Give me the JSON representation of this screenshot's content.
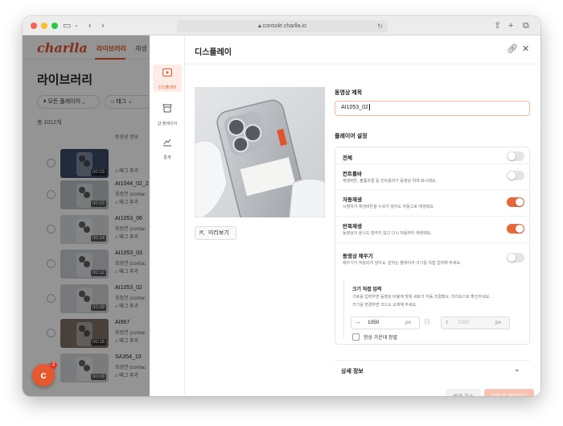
{
  "browser": {
    "url": "console.charlla.io"
  },
  "app": {
    "logo": "charlla",
    "nav": {
      "library": "라이브러리",
      "playlist": "재생"
    },
    "page_title": "라이브러리",
    "filters": {
      "all_playlists": "모든 플레이어",
      "tags": "태그"
    },
    "total": "총 1012개",
    "col_header": "동영상 정보",
    "rows": [
      {
        "name": "",
        "owner": "",
        "tag": "태그 추가",
        "duration": "00:03"
      },
      {
        "name": "AI1044_02_2",
        "owner": "최정연 (contac",
        "tag": "태그 추가",
        "duration": "00:03"
      },
      {
        "name": "AI1053_06",
        "owner": "최정연 (contac",
        "tag": "태그 추가",
        "duration": "00:14"
      },
      {
        "name": "AI1053_03",
        "owner": "최정연 (contac",
        "tag": "태그 추가",
        "duration": "00:12"
      },
      {
        "name": "AI1053_02",
        "owner": "최정연 (contac",
        "tag": "태그 추가",
        "duration": "00:09"
      },
      {
        "name": "AI967",
        "owner": "최정연 (contac",
        "tag": "태그 추가",
        "duration": "00:16"
      },
      {
        "name": "SA354_10",
        "owner": "최정연 (contac",
        "tag": "태그 추가",
        "duration": "00:08"
      }
    ],
    "chat_badge": "2"
  },
  "drawer": {
    "side": [
      {
        "label": "디스플레이",
        "icon": "play-icon"
      },
      {
        "label": "샵 플레이어",
        "icon": "shop-icon"
      },
      {
        "label": "통계",
        "icon": "chart-icon"
      }
    ],
    "title": "디스플레이",
    "preview_button": "미리보기",
    "video_title_label": "동영상 제목",
    "video_title_value": "AI1053_02",
    "player_settings_label": "플레이어 설정",
    "settings": [
      {
        "name": "전체",
        "desc": "",
        "on": false
      },
      {
        "name": "컨트롤바",
        "desc": "재생버튼, 볼륨조절 등 컨트롤바가 동영상 위에 표시돼요.",
        "on": false
      },
      {
        "name": "자동재생",
        "desc": "시청자가 재생버튼을 누르지 않아도 자동으로 재생돼요.",
        "on": true
      },
      {
        "name": "반복재생",
        "desc": "동영상이 끝나도 멈추지 않고 다시 처음부터 재생돼요.",
        "on": true
      },
      {
        "name": "동영상 채우기",
        "desc": "채우기가 적용되지 않아요. 원하는 플레이어 크기를 직접 입력해 주세요.",
        "on": false
      }
    ],
    "size_input": {
      "title": "크기 직접 입력",
      "desc1": "가로를 입력하면 동영상 비율에 맞춰 세로가 자동 조절돼요. 미리보기로 확인하세요.",
      "desc2": "크기를 변경하면 코드도 교체해 주세요.",
      "width": "1050",
      "height": "1050",
      "unit": "px",
      "center_label": "항상 가운데 정렬"
    },
    "detail_label": "상세 정보",
    "cancel_button": "변경 취소",
    "save_button": "저장 및 업데이트"
  },
  "colors": {
    "brand": "#e2542a",
    "toggle_on": "#e8673a",
    "save_disabled": "#f7c3af"
  }
}
